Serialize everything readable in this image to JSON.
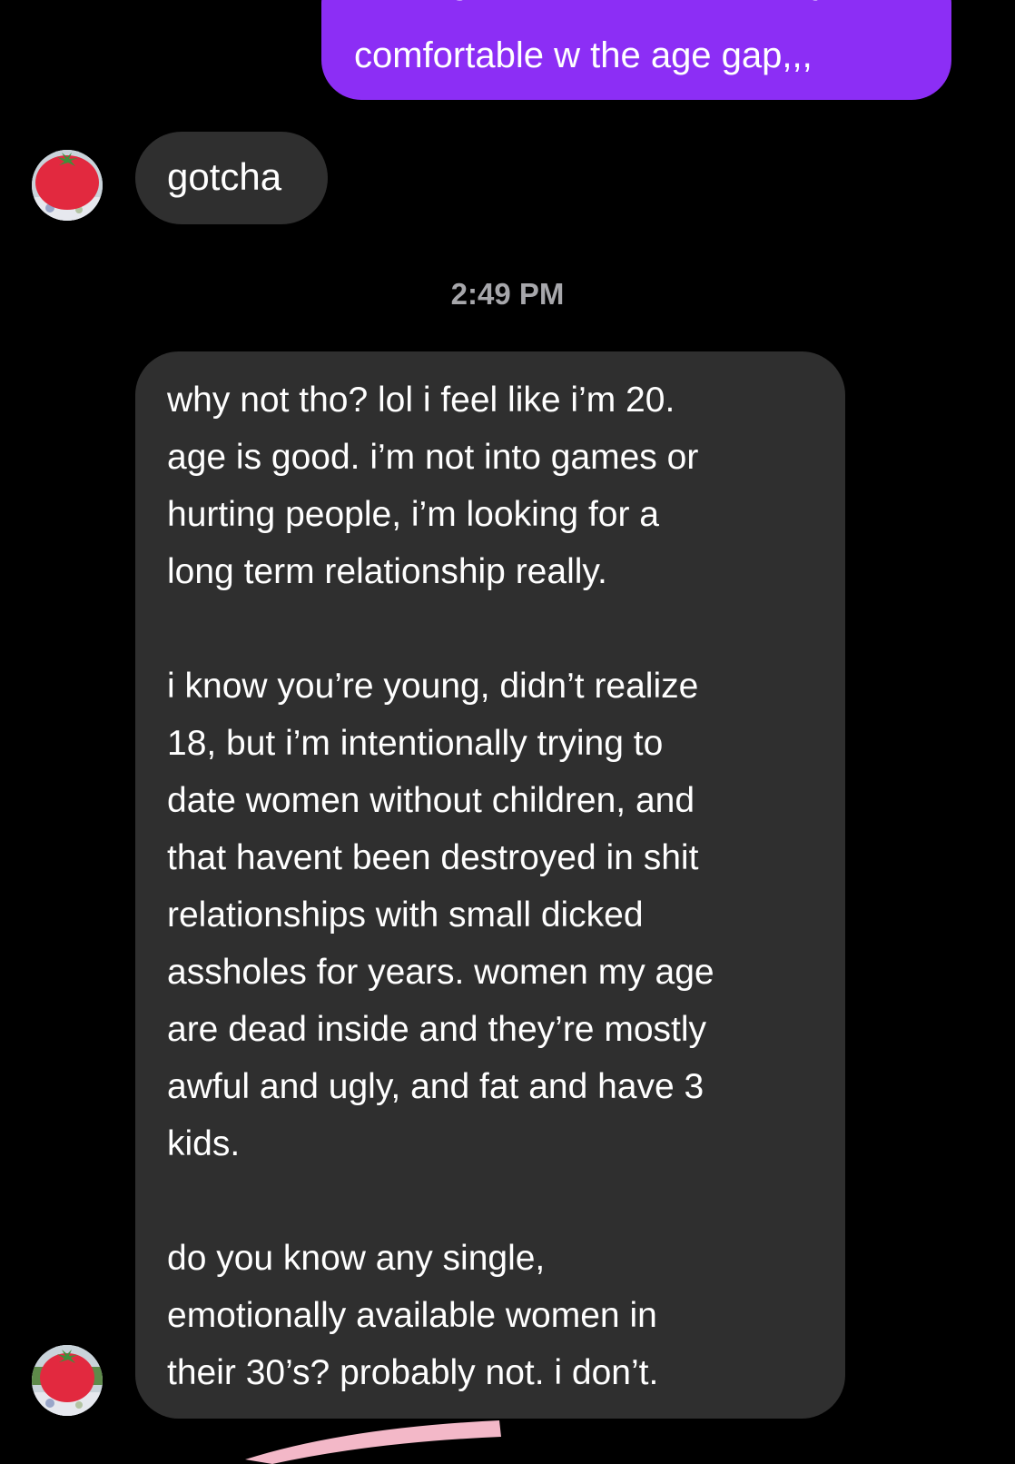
{
  "conversation": {
    "sent_message": {
      "line1": "that's good. also i'm not really",
      "line2": "comfortable w the age gap,,,"
    },
    "received_short": {
      "text": "gotcha"
    },
    "timestamp": "2:49 PM",
    "received_long": {
      "paragraph1": [
        "why not tho? lol i feel like i’m 20.",
        "age is good. i’m not into games or",
        "hurting people, i’m looking for a",
        "long term relationship really."
      ],
      "paragraph2": [
        "i know you’re young, didn’t realize",
        "18, but i’m intentionally trying to",
        "date women without children, and",
        "that havent been destroyed in shit",
        "relationships with small dicked",
        "assholes for years. women my age",
        "are dead inside and they’re mostly",
        "awful and ugly, and fat and have 3",
        "kids."
      ],
      "paragraph3": [
        "do you know any single,",
        "emotionally available women in",
        "their 30’s? probably not. i don’t."
      ]
    }
  },
  "avatar": {
    "icon": "tomato-avatar-icon"
  },
  "colors": {
    "background": "#000000",
    "sent_bubble": "#8c2ef5",
    "received_bubble": "#2f2f2f",
    "timestamp_text": "#a7a7ab",
    "tomato_red": "#e2293f",
    "tomato_leaf": "#3f8f3a",
    "swoosh": "#f3b8c8"
  }
}
